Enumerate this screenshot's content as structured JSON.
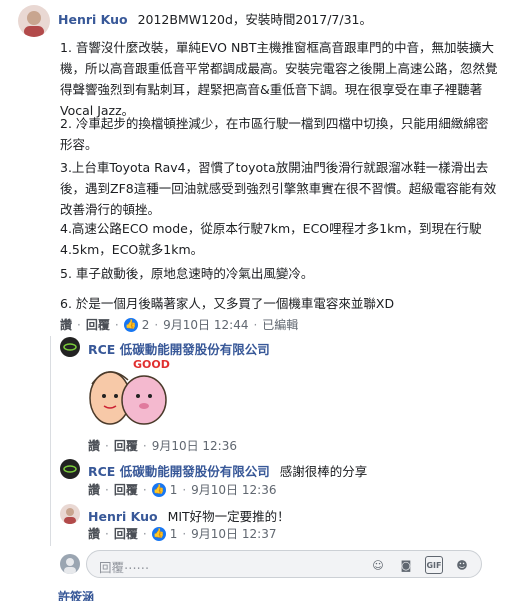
{
  "post": {
    "author": "Henri Kuo",
    "header_text": "2012BMW120d，安裝時間2017/7/31。",
    "paragraphs": [
      "1. 音響沒什麼改裝，單純EVO NBT主機推窗框高音跟車門的中音，無加裝擴大機，所以高音跟重低音平常都調成最高。安裝完電容之後開上高速公路，忽然覺得聲響強烈到有點刺耳，趕緊把高音&重低音下調。現在很享受在車子裡聽著Vocal Jazz。",
      "2. 冷車起步的換檔頓挫減少，在市區行駛一檔到四檔中切換，只能用細緻綿密形容。",
      "3.上台車Toyota Rav4，習慣了toyota放開油門後滑行就跟溜冰鞋一樣滑出去後，遇到ZF8這種一回油就感受到強烈引擎煞車實在很不習慣。超級電容能有效改善滑行的頓挫。",
      "4.高速公路ECO mode，從原本行駛7km，ECO哩程才多1km，到現在行駛4.5km，ECO就多1km。",
      "5. 車子啟動後，原地怠速時的冷氣出風變冷。",
      "6. 於是一個月後瞞著家人，又多買了一個機車電容來並聯XD"
    ],
    "actions": {
      "like": "讚",
      "reply": "回覆",
      "like_count": "2",
      "time": "9月10日 12:44",
      "edited": "已編輯"
    }
  },
  "replies": [
    {
      "author": "RCE 低碳動能開發股份有限公司",
      "sticker_text": "GOOD!",
      "actions": {
        "like": "讚",
        "reply": "回覆",
        "time": "9月10日 12:36"
      }
    },
    {
      "author": "RCE 低碳動能開發股份有限公司",
      "text": "感謝很棒的分享",
      "actions": {
        "like": "讚",
        "reply": "回覆",
        "like_count": "1",
        "time": "9月10日 12:36"
      }
    },
    {
      "author": "Henri Kuo",
      "text": "MIT好物一定要推的！",
      "actions": {
        "like": "讚",
        "reply": "回覆",
        "like_count": "1",
        "time": "9月10日 12:37"
      }
    }
  ],
  "composer": {
    "placeholder": "回覆⋯⋯",
    "icons": [
      "emoji-icon",
      "camera-icon",
      "gif-icon",
      "sticker-icon"
    ]
  },
  "next_comment_author": "許筱涵",
  "colors": {
    "link": "#385898",
    "meta": "#606770",
    "accent": "#1877f2"
  }
}
